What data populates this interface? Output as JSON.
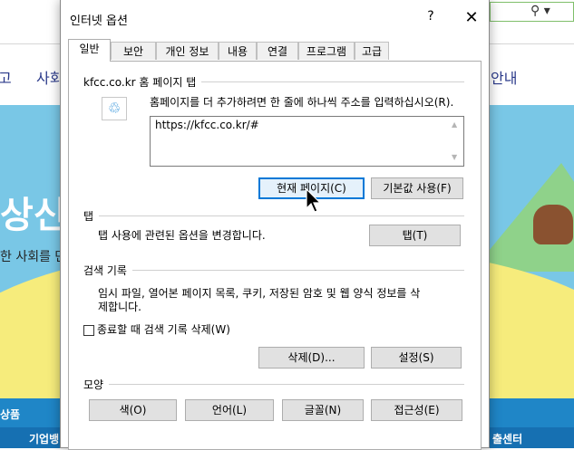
{
  "background": {
    "nav_left": "고",
    "nav_item": "사회",
    "nav_right": "안내",
    "hero_text": "상신",
    "hero_sub": "한 사회를 만",
    "footer_left": "상품",
    "footer_bottom_left": "기업뱅",
    "footer_bottom_right": "출센터",
    "search_glyph": "⚲ ▾"
  },
  "dialog": {
    "title": "인터넷 옵션",
    "help": "?",
    "close": "✕",
    "tabs": [
      "일반",
      "보안",
      "개인 정보",
      "내용",
      "연결",
      "프로그램",
      "고급"
    ],
    "homepage": {
      "group_label": "kfcc.co.kr 홈 페이지 탭",
      "instruction": "홈페이지를 더 추가하려면 한 줄에 하나씩 주소를 입력하십시오(R).",
      "url_value": "https://kfcc.co.kr/#",
      "current_button": "현재 페이지(C)",
      "default_button": "기본값 사용(F)"
    },
    "tabs_group": {
      "group_label": "탭",
      "description": "탭 사용에 관련된 옵션을 변경합니다.",
      "tabs_button": "탭(T)"
    },
    "history": {
      "group_label": "검색 기록",
      "description_line1": "임시 파일, 열어본 페이지 목록, 쿠키, 저장된 암호 및 웹 양식 정보를 삭",
      "description_line2": "제합니다.",
      "checkbox_label": "종료할 때 검색 기록 삭제(W)",
      "checkbox_checked": false,
      "delete_button": "삭제(D)...",
      "settings_button": "설정(S)"
    },
    "appearance": {
      "group_label": "모양",
      "colors_button": "색(O)",
      "languages_button": "언어(L)",
      "fonts_button": "글꼴(N)",
      "accessibility_button": "접근성(E)"
    }
  },
  "colors": {
    "accent": "#0078d7",
    "sky": "#79c7e6",
    "hill": "#f6ec7c",
    "footer": "#1f86c7"
  }
}
